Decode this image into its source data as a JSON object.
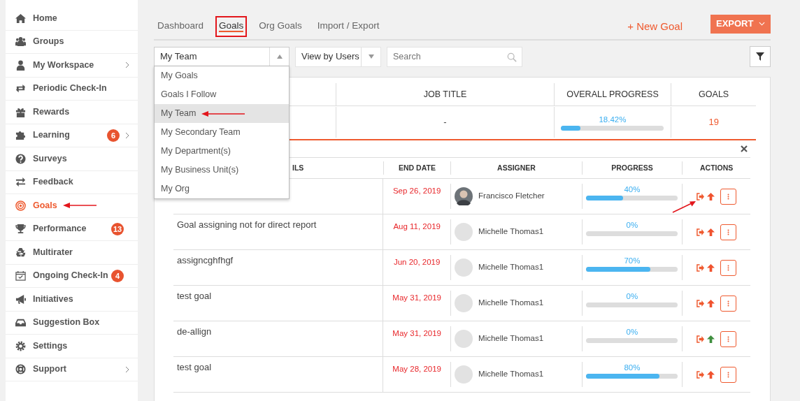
{
  "sidebar": {
    "items": [
      {
        "label": "Home",
        "selected": false,
        "annotated": false,
        "submenu": false
      },
      {
        "label": "Groups",
        "selected": false,
        "annotated": false,
        "submenu": false
      },
      {
        "label": "My Workspace",
        "selected": false,
        "annotated": false,
        "submenu": true
      },
      {
        "label": "Periodic Check-In",
        "selected": false,
        "annotated": false,
        "submenu": false
      },
      {
        "label": "Rewards",
        "selected": false,
        "annotated": false,
        "submenu": false
      },
      {
        "label": "Learning",
        "selected": false,
        "annotated": false,
        "submenu": true,
        "badge": "6"
      },
      {
        "label": "Surveys",
        "selected": false,
        "annotated": false,
        "submenu": false
      },
      {
        "label": "Feedback",
        "selected": false,
        "annotated": false,
        "submenu": false
      },
      {
        "label": "Goals",
        "selected": true,
        "annotated": true,
        "submenu": false
      },
      {
        "label": "Performance",
        "selected": false,
        "annotated": false,
        "submenu": false,
        "badge": "13"
      },
      {
        "label": "Multirater",
        "selected": false,
        "annotated": false,
        "submenu": false
      },
      {
        "label": "Ongoing Check-In",
        "selected": false,
        "annotated": false,
        "submenu": false,
        "badge": "4"
      },
      {
        "label": "Initiatives",
        "selected": false,
        "annotated": false,
        "submenu": false
      },
      {
        "label": "Suggestion Box",
        "selected": false,
        "annotated": false,
        "submenu": false
      },
      {
        "label": "Settings",
        "selected": false,
        "annotated": false,
        "submenu": false
      },
      {
        "label": "Support",
        "selected": false,
        "annotated": false,
        "submenu": true
      }
    ]
  },
  "tabs": [
    {
      "label": "Dashboard",
      "selected": false,
      "annotated": false
    },
    {
      "label": "Goals",
      "selected": true,
      "annotated": true
    },
    {
      "label": "Org Goals",
      "selected": false,
      "annotated": false
    },
    {
      "label": "Import / Export",
      "selected": false,
      "annotated": false
    }
  ],
  "new_goal_link": "+ New Goal",
  "export_button": "EXPORT",
  "scope_select": {
    "value": "My Team",
    "expanded": true,
    "options": [
      {
        "label": "My Goals",
        "selected": false,
        "annotated": false
      },
      {
        "label": "Goals I Follow",
        "selected": false,
        "annotated": false
      },
      {
        "label": "My Team",
        "selected": true,
        "annotated": true
      },
      {
        "label": "My Secondary Team",
        "selected": false,
        "annotated": false
      },
      {
        "label": "My Department(s)",
        "selected": false,
        "annotated": false
      },
      {
        "label": "My Business Unit(s)",
        "selected": false,
        "annotated": false
      },
      {
        "label": "My Org",
        "selected": false,
        "annotated": false
      }
    ]
  },
  "view_select": {
    "value": "View by Users"
  },
  "search": {
    "placeholder": "Search"
  },
  "user_table": {
    "columns": [
      "JOB TITLE",
      "OVERALL PROGRESS",
      "GOALS"
    ],
    "rows": [
      {
        "job_title": "-",
        "progress": "18.42%",
        "level": 0.1842,
        "goals": "19"
      }
    ]
  },
  "goals_table": {
    "columns": [
      "ILS",
      "END DATE",
      "ASSIGNER",
      "PROGRESS",
      "ACTIONS"
    ],
    "rows": [
      {
        "end_date": "Sep 26, 2019",
        "assigner": "Francisco Fletcher",
        "has_photo": true,
        "progress": "40%",
        "level": 0.4,
        "color": "#f0522e",
        "annotated": true
      },
      {
        "title": "Goal assigning not for direct report",
        "end_date": "Aug 11, 2019",
        "assigner": "Michelle Thomas1",
        "has_photo": false,
        "progress": "0%",
        "level": 0,
        "color": "#f0522e",
        "annotated": false
      },
      {
        "title": "assigncghfhgf",
        "end_date": "Jun 20, 2019",
        "assigner": "Michelle Thomas1",
        "has_photo": false,
        "progress": "70%",
        "level": 0.7,
        "color": "#f0522e",
        "annotated": false
      },
      {
        "title": "test goal",
        "end_date": "May 31, 2019",
        "assigner": "Michelle Thomas1",
        "has_photo": false,
        "progress": "0%",
        "level": 0,
        "color": "#f0522e",
        "annotated": false
      },
      {
        "title": "de-allign",
        "end_date": "May 31, 2019",
        "assigner": "Michelle Thomas1",
        "has_photo": false,
        "progress": "0%",
        "level": 0,
        "color": "#3f8f3f",
        "annotated": false
      },
      {
        "title": "test goal",
        "end_date": "May 28, 2019",
        "assigner": "Michelle Thomas1",
        "has_photo": false,
        "progress": "80%",
        "level": 0.8,
        "color": "#f0522e",
        "annotated": false
      }
    ]
  }
}
